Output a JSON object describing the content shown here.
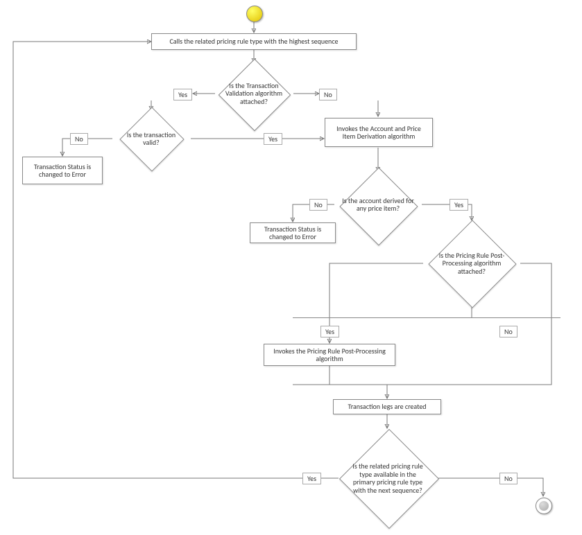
{
  "nodes": {
    "start": {
      "type": "start"
    },
    "n1": {
      "text": "Calls the related pricing rule type with the highest sequence"
    },
    "d1": {
      "text": "Is the Transaction Validation algorithm attached?"
    },
    "d2": {
      "text": "Is the transaction valid?"
    },
    "n2": {
      "text": "Transaction Status is changed to Error"
    },
    "n3": {
      "text": "Invokes the Account and Price Item Derivation algorithm"
    },
    "d3": {
      "text": "Is the account derived for any price item?"
    },
    "n4": {
      "text": "Transaction Status is changed to Error"
    },
    "d4": {
      "text": "Is the Pricing Rule Post-Processing algorithm attached?"
    },
    "n5": {
      "text": "Invokes the Pricing Rule Post-Processing algorithm"
    },
    "n6": {
      "text": "Transaction legs are created"
    },
    "d5": {
      "text": "Is the related pricing rule type available in the primary pricing rule type with the next sequence?"
    },
    "end": {
      "type": "end"
    }
  },
  "edge_labels": {
    "yes": "Yes",
    "no": "No"
  }
}
